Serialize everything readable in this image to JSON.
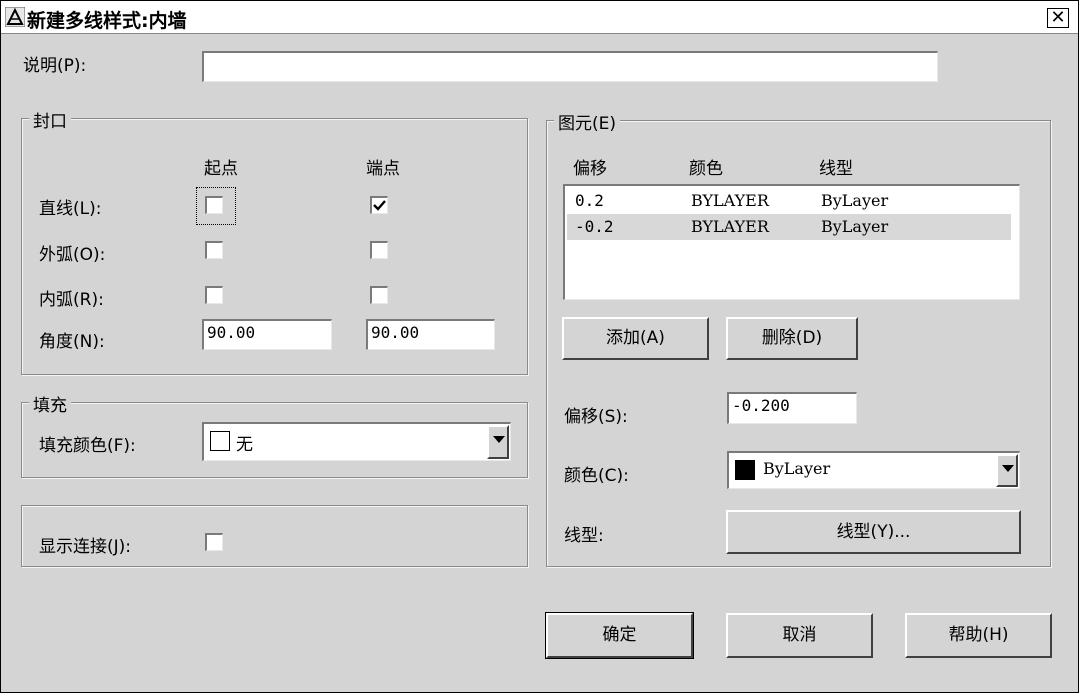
{
  "window": {
    "title": "新建多线样式:内墙",
    "close_glyph": "✕"
  },
  "description": {
    "label": "说明(P):",
    "value": ""
  },
  "caps": {
    "group_label": "封口",
    "col_start": "起点",
    "col_end": "端点",
    "rows": [
      {
        "label": "直线(L):",
        "start_checked": false,
        "end_checked": true
      },
      {
        "label": "外弧(O):",
        "start_checked": false,
        "end_checked": false
      },
      {
        "label": "内弧(R):",
        "start_checked": false,
        "end_checked": false
      }
    ],
    "angle_label": "角度(N):",
    "angle_start": "90.00",
    "angle_end": "90.00"
  },
  "fill": {
    "group_label": "填充",
    "color_label": "填充颜色(F):",
    "color_value": "无",
    "swatch_color": "#ffffff"
  },
  "joints": {
    "label": "显示连接(J):",
    "checked": false
  },
  "elements": {
    "group_label": "图元(E)",
    "headers": {
      "offset": "偏移",
      "color": "颜色",
      "linetype": "线型"
    },
    "rows": [
      {
        "offset": "0.2",
        "color": "BYLAYER",
        "linetype": "ByLayer",
        "selected": false
      },
      {
        "offset": "-0.2",
        "color": "BYLAYER",
        "linetype": "ByLayer",
        "selected": true
      }
    ],
    "add_label": "添加(A)",
    "delete_label": "删除(D)",
    "offset_label": "偏移(S):",
    "offset_value": "-0.200",
    "color_label": "颜色(C):",
    "color_value": "ByLayer",
    "color_swatch": "#000000",
    "linetype_label": "线型:",
    "linetype_button": "线型(Y)..."
  },
  "buttons": {
    "ok": "确定",
    "cancel": "取消",
    "help": "帮助(H)"
  }
}
